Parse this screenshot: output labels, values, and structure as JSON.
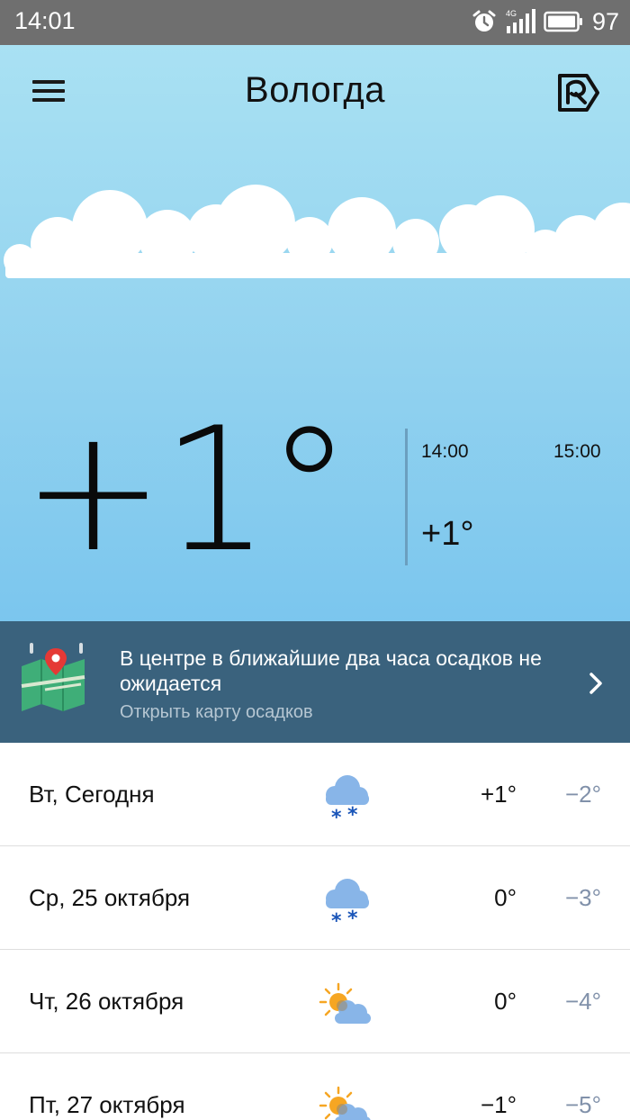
{
  "status_bar": {
    "time": "14:01",
    "network": "4G",
    "battery": "97",
    "icons": [
      "alarm-icon",
      "signal-icon",
      "battery-icon"
    ]
  },
  "header": {
    "city": "Вологда",
    "menu_icon": "hamburger-icon",
    "logo_icon": "yandex-weather-logo-icon"
  },
  "current": {
    "temperature": "+1°"
  },
  "hourly": [
    {
      "time": "14:00",
      "temp": "+1°"
    },
    {
      "time": "15:00",
      "temp": ""
    }
  ],
  "precipitation": {
    "message": "В центре в ближайшие два часа осадков не ожидается",
    "link": "Открыть карту осадков",
    "icon": "map-icon"
  },
  "forecast": [
    {
      "day": "Вт, Сегодня",
      "icon": "snow-cloud-icon",
      "high": "+1°",
      "low": "−2°"
    },
    {
      "day": "Ср, 25 октября",
      "icon": "snow-cloud-icon",
      "high": "0°",
      "low": "−3°"
    },
    {
      "day": "Чт, 26 октября",
      "icon": "partly-cloudy-icon",
      "high": "0°",
      "low": "−4°"
    },
    {
      "day": "Пт, 27 октября",
      "icon": "partly-cloudy-icon",
      "high": "−1°",
      "low": "−5°"
    }
  ],
  "colors": {
    "status_bar": "#6f6f6f",
    "sky_top": "#a9e1f3",
    "sky_bottom": "#7bc6ee",
    "banner": "#3a627d",
    "low_temp": "#8191aa",
    "snow_flake": "#1a55b8",
    "sun": "#f6a623"
  }
}
